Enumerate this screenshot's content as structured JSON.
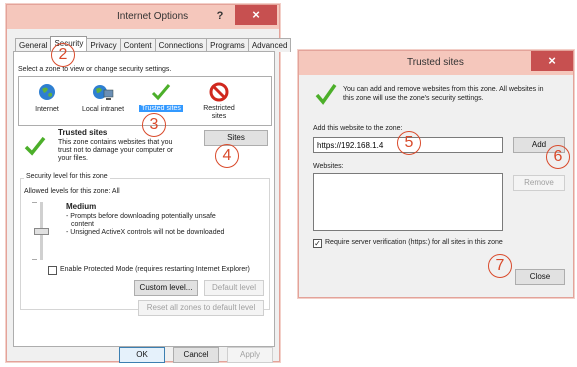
{
  "io": {
    "title": "Internet Options",
    "help": "?",
    "close": "×",
    "tabs": [
      "General",
      "Security",
      "Privacy",
      "Content",
      "Connections",
      "Programs",
      "Advanced"
    ],
    "select_zone": "Select a zone to view or change security settings.",
    "zones": [
      "Internet",
      "Local intranet",
      "Trusted sites",
      "Restricted\nsites"
    ],
    "zone_title": "Trusted sites",
    "zone_desc": [
      "This zone contains websites that you",
      "trust not to damage your computer or",
      "your files."
    ],
    "sites_button": "Sites",
    "security_level_title": "Security level for this zone",
    "allowed_levels": "Allowed levels for this zone: All",
    "level_name": "Medium",
    "level_desc": [
      "- Prompts before downloading potentially unsafe",
      "content",
      "- Unsigned ActiveX controls will not be downloaded"
    ],
    "protected_mode": "Enable Protected Mode (requires restarting Internet Explorer)",
    "custom_level": "Custom level...",
    "default_level": "Default level",
    "reset_all": "Reset all zones to default level",
    "ok": "OK",
    "cancel": "Cancel",
    "apply": "Apply"
  },
  "ts": {
    "title": "Trusted sites",
    "close": "×",
    "info": [
      "You can add and remove websites from this zone. All websites in",
      "this zone will use the zone's security settings."
    ],
    "add_label": "Add this website to the zone:",
    "add_value": "https://192.168.1.4",
    "add_button": "Add",
    "websites_label": "Websites:",
    "remove_button": "Remove",
    "require_https": "Require server verification (https:) for all sites in this zone",
    "close_button": "Close"
  },
  "callouts": [
    "2",
    "3",
    "4",
    "5",
    "6",
    "7"
  ],
  "colors": {
    "titlebar": "#f5c7bc",
    "close_button": "#c75050",
    "callout": "#d94a2b",
    "selection": "#3399ff",
    "check": "#4caf2a"
  }
}
